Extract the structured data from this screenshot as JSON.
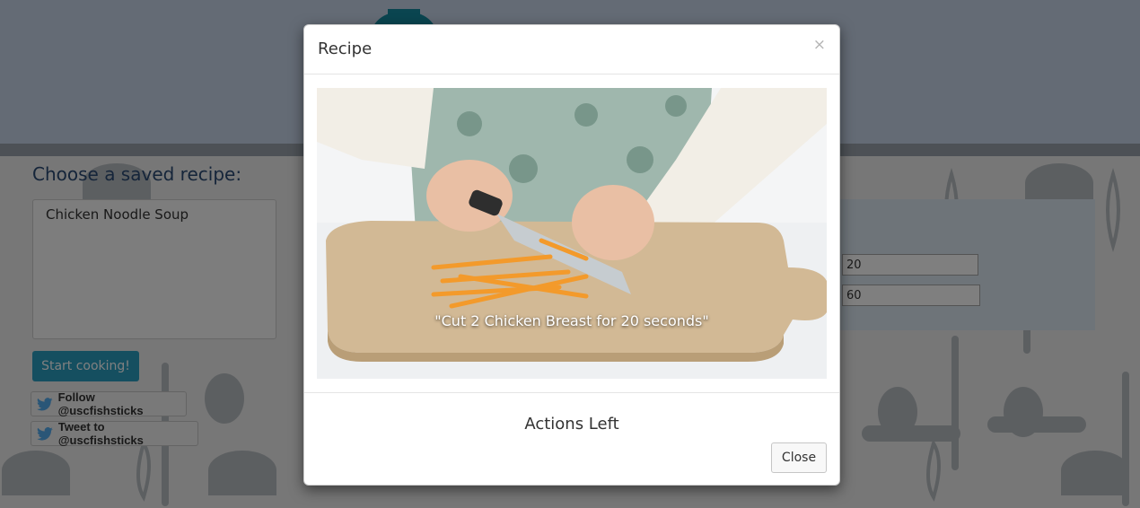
{
  "background": {
    "saved_recipe_heading": "Choose a saved recipe:",
    "recipe_list": [
      "Chicken Noodle Soup"
    ],
    "start_button": "Start cooking!",
    "twitter_follow": "Follow @uscfishsticks",
    "twitter_tweet": "Tweet to @uscfishsticks",
    "input_1_value": "20",
    "input_2_value": "60",
    "colors": {
      "header": "#c9d7ea",
      "accent": "#2b9fc1",
      "heading": "#2b4a74"
    }
  },
  "modal": {
    "title": "Recipe",
    "close_x": "×",
    "step_caption": "\"Cut 2 Chicken Breast for 20 seconds\"",
    "actions_label": "Actions Left",
    "close_button": "Close"
  }
}
